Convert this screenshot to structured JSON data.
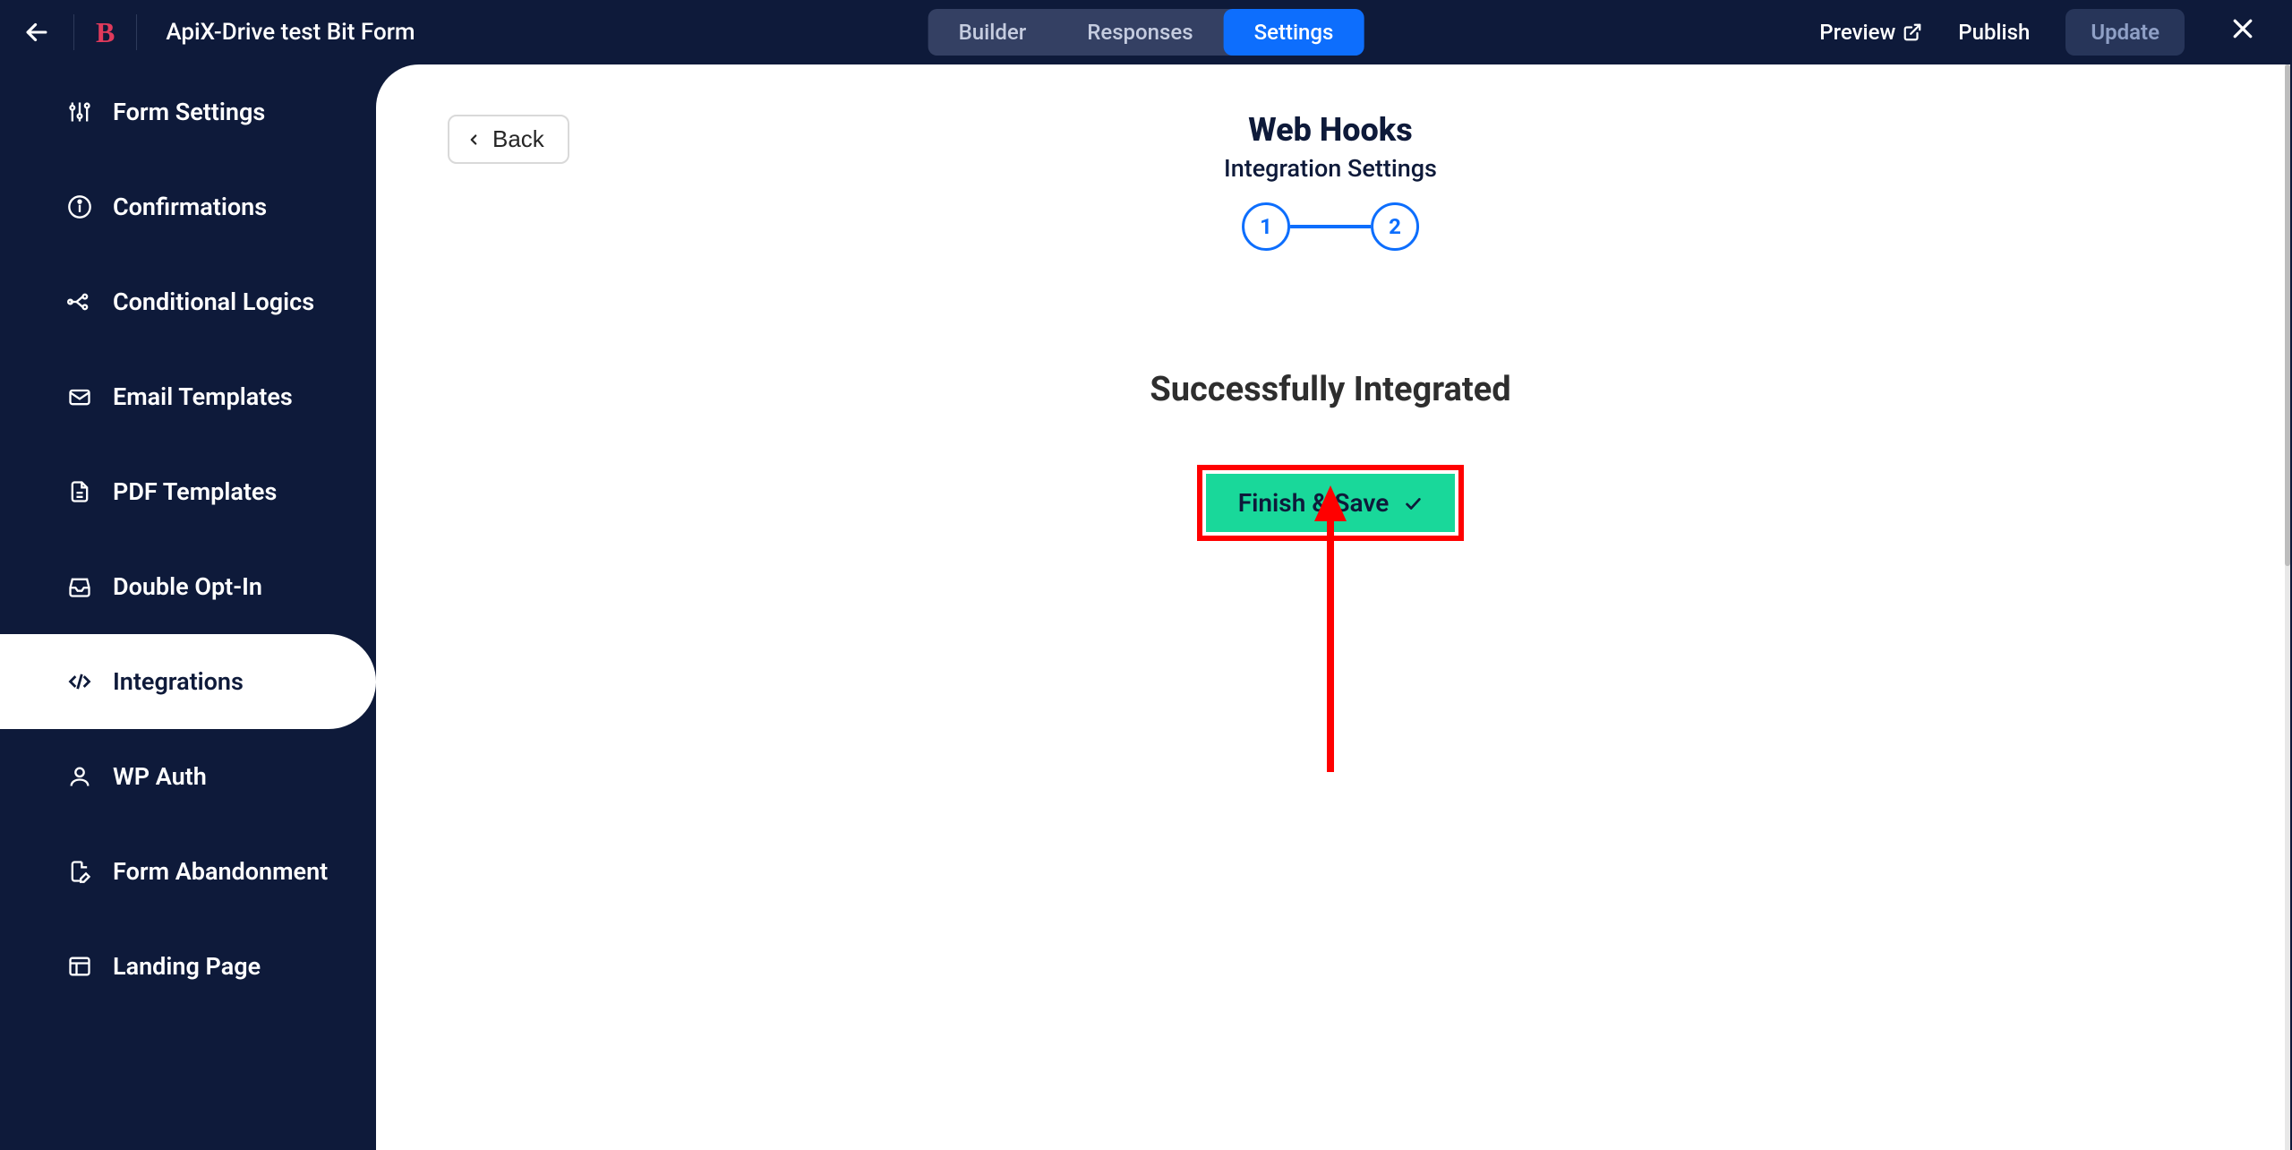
{
  "header": {
    "form_title": "ApiX-Drive test Bit Form",
    "tabs": {
      "builder": "Builder",
      "responses": "Responses",
      "settings": "Settings"
    },
    "preview": "Preview",
    "publish": "Publish",
    "update": "Update"
  },
  "sidebar": {
    "items": [
      {
        "label": "Form Settings"
      },
      {
        "label": "Confirmations"
      },
      {
        "label": "Conditional Logics"
      },
      {
        "label": "Email Templates"
      },
      {
        "label": "PDF Templates"
      },
      {
        "label": "Double Opt-In"
      },
      {
        "label": "Integrations"
      },
      {
        "label": "WP Auth"
      },
      {
        "label": "Form Abandonment"
      },
      {
        "label": "Landing Page"
      }
    ]
  },
  "main": {
    "back": "Back",
    "title": "Web Hooks",
    "subtitle": "Integration Settings",
    "step1": "1",
    "step2": "2",
    "success": "Successfully Integrated",
    "finish": "Finish & Save"
  }
}
